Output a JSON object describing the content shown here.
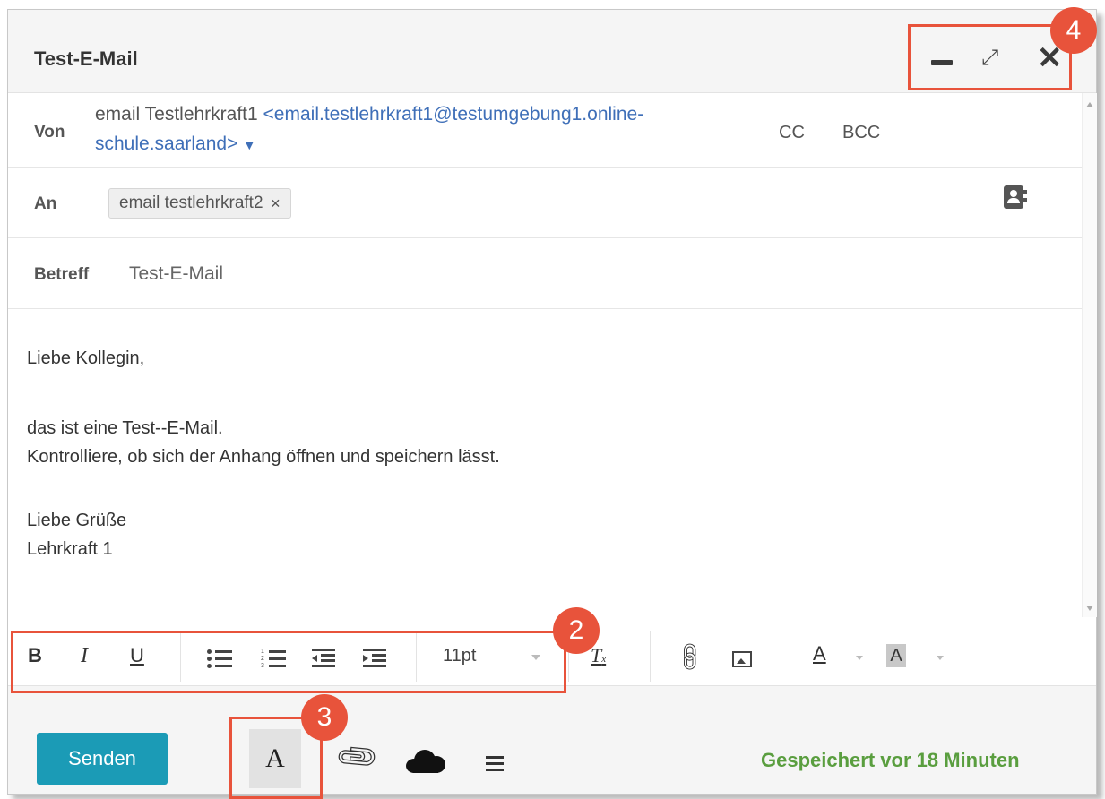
{
  "window": {
    "title": "Test-E-Mail"
  },
  "header": {
    "from_label": "Von",
    "from_name": "email Testlehrkraft1",
    "from_address_1": "<email.testlehrkraft1@testumgebung1.online-",
    "from_address_2": "schule.saarland>",
    "cc_label": "CC",
    "bcc_label": "BCC",
    "to_label": "An",
    "to_recipient": "email testlehrkraft2",
    "subject_label": "Betreff",
    "subject_value": "Test-E-Mail"
  },
  "body": {
    "lines": [
      "Liebe Kollegin,",
      "das ist eine Test--E-Mail.",
      "Kontrolliere, ob sich der Anhang öffnen und speichern lässt.",
      "Liebe Grüße",
      "Lehrkraft 1"
    ]
  },
  "toolbar": {
    "bold": "B",
    "italic": "I",
    "underline": "U",
    "font_size": "11pt",
    "clear_format": "T",
    "text_color": "A",
    "background_color": "A"
  },
  "footer": {
    "send_label": "Senden",
    "format_toggle": "A",
    "saved_status": "Gespeichert vor 18 Minuten"
  },
  "annotations": {
    "badge_2": "2",
    "badge_3": "3",
    "badge_4": "4"
  },
  "colors": {
    "accent": "#1b9bb6",
    "annotation": "#e8533b",
    "saved_status": "#5a9e3f",
    "link": "#3f6fb8"
  }
}
